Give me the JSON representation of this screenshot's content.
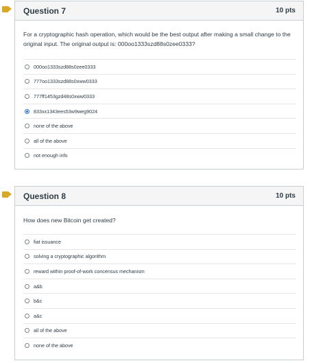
{
  "questions": [
    {
      "title": "Question 7",
      "points": "10 pts",
      "text": "For a cryptographic hash operation, which would be the best output after making a small change to the original input. The original output is: 000oo1333szd88s0zee0333?",
      "answers": [
        {
          "label": "000oo1333szd88s0zee0333",
          "selected": false
        },
        {
          "label": "777oo1333szd88s0xww0333",
          "selected": false
        },
        {
          "label": "777ff1453gzd48s0xww0333",
          "selected": false
        },
        {
          "label": "833xx1343ees53w9weg9024",
          "selected": true
        },
        {
          "label": "none of the above",
          "selected": false
        },
        {
          "label": "all of the above",
          "selected": false
        },
        {
          "label": "not enough info",
          "selected": false
        }
      ]
    },
    {
      "title": "Question 8",
      "points": "10 pts",
      "text": "How does new Bitcoin get created?",
      "answers": [
        {
          "label": "fiat issuance",
          "selected": false
        },
        {
          "label": "solving a cryptographic algorithm",
          "selected": false
        },
        {
          "label": "reward within proof-of-work concensus mechanism",
          "selected": false
        },
        {
          "label": "a&b",
          "selected": false
        },
        {
          "label": "b&c",
          "selected": false
        },
        {
          "label": "a&c",
          "selected": false
        },
        {
          "label": "all of the above",
          "selected": false
        },
        {
          "label": "none of the above",
          "selected": false
        }
      ]
    }
  ],
  "colors": {
    "flag": "#d9a827",
    "selected_radio": "#2a6bd6",
    "border": "#c7cdd1",
    "header_bg": "#f5f5f5"
  },
  "icons": {
    "flag": "bookmark-flag-icon"
  }
}
